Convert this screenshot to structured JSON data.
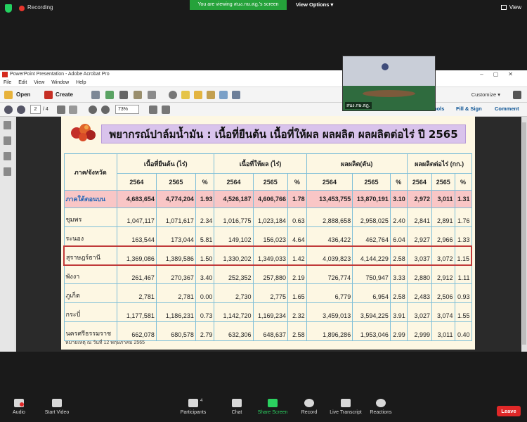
{
  "zoom": {
    "recording": "Recording",
    "viewing_banner": "You are viewing สนง.กษ.สฎ.'s screen",
    "view_options": "View Options",
    "view": "View",
    "participants_count": "4",
    "toolbar": [
      "Audio",
      "Start Video",
      "Participants",
      "Chat",
      "Share Screen",
      "Record",
      "Live Transcript",
      "Reactions"
    ],
    "leave": "Leave",
    "video_name": "สนง.กษ.สฎ."
  },
  "acrobat": {
    "title": "PowerPoint Presentation - Adobe Acrobat Pro",
    "menu": [
      "File",
      "Edit",
      "View",
      "Window",
      "Help"
    ],
    "open": "Open",
    "create": "Create",
    "page_current": "2",
    "page_total": "/ 4",
    "zoom_level": "73%",
    "customize": "Customize",
    "tools": "Tools",
    "fill_sign": "Fill & Sign",
    "comment": "Comment"
  },
  "slide": {
    "title": "พยากรณ์ปาล์มน้ำมัน : เนื้อที่ยืนต้น เนื้อที่ให้ผล ผลผลิต ผลผลิตต่อไร่ ปี 2565",
    "header_region": "ภาค/จังหวัด",
    "groups": [
      "เนื้อที่ยืนต้น (ไร่)",
      "เนื้อที่ให้ผล (ไร่)",
      "ผลผลิต(ตัน)",
      "ผลผลิตต่อไร่ (กก.)"
    ],
    "year_a": "2564",
    "year_b": "2565",
    "pct": "%",
    "footnote": "หมายเหตุ ณ วันที่ 12 พฤษภาคม 2565",
    "south": [
      "ภาคใต้ตอนบน",
      "4,683,654",
      "4,774,204",
      "1.93",
      "4,526,187",
      "4,606,766",
      "1.78",
      "13,453,755",
      "13,870,191",
      "3.10",
      "2,972",
      "3,011",
      "1.31"
    ],
    "rows": [
      [
        "ชุมพร",
        "1,047,117",
        "1,071,617",
        "2.34",
        "1,016,775",
        "1,023,184",
        "0.63",
        "2,888,658",
        "2,958,025",
        "2.40",
        "2,841",
        "2,891",
        "1.76"
      ],
      [
        "ระนอง",
        "163,544",
        "173,044",
        "5.81",
        "149,102",
        "156,023",
        "4.64",
        "436,422",
        "462,764",
        "6.04",
        "2,927",
        "2,966",
        "1.33"
      ],
      [
        "สุราษฎร์ธานี",
        "1,369,086",
        "1,389,586",
        "1.50",
        "1,330,202",
        "1,349,033",
        "1.42",
        "4,039,823",
        "4,144,229",
        "2.58",
        "3,037",
        "3,072",
        "1.15"
      ],
      [
        "พังงา",
        "261,467",
        "270,367",
        "3.40",
        "252,352",
        "257,880",
        "2.19",
        "726,774",
        "750,947",
        "3.33",
        "2,880",
        "2,912",
        "1.11"
      ],
      [
        "ภูเก็ต",
        "2,781",
        "2,781",
        "0.00",
        "2,730",
        "2,775",
        "1.65",
        "6,779",
        "6,954",
        "2.58",
        "2,483",
        "2,506",
        "0.93"
      ],
      [
        "กระบี่",
        "1,177,581",
        "1,186,231",
        "0.73",
        "1,142,720",
        "1,169,234",
        "2.32",
        "3,459,013",
        "3,594,225",
        "3.91",
        "3,027",
        "3,074",
        "1.55"
      ],
      [
        "นครศรีธรรมราช",
        "662,078",
        "680,578",
        "2.79",
        "632,306",
        "648,637",
        "2.58",
        "1,896,286",
        "1,953,046",
        "2.99",
        "2,999",
        "3,011",
        "0.40"
      ]
    ]
  }
}
